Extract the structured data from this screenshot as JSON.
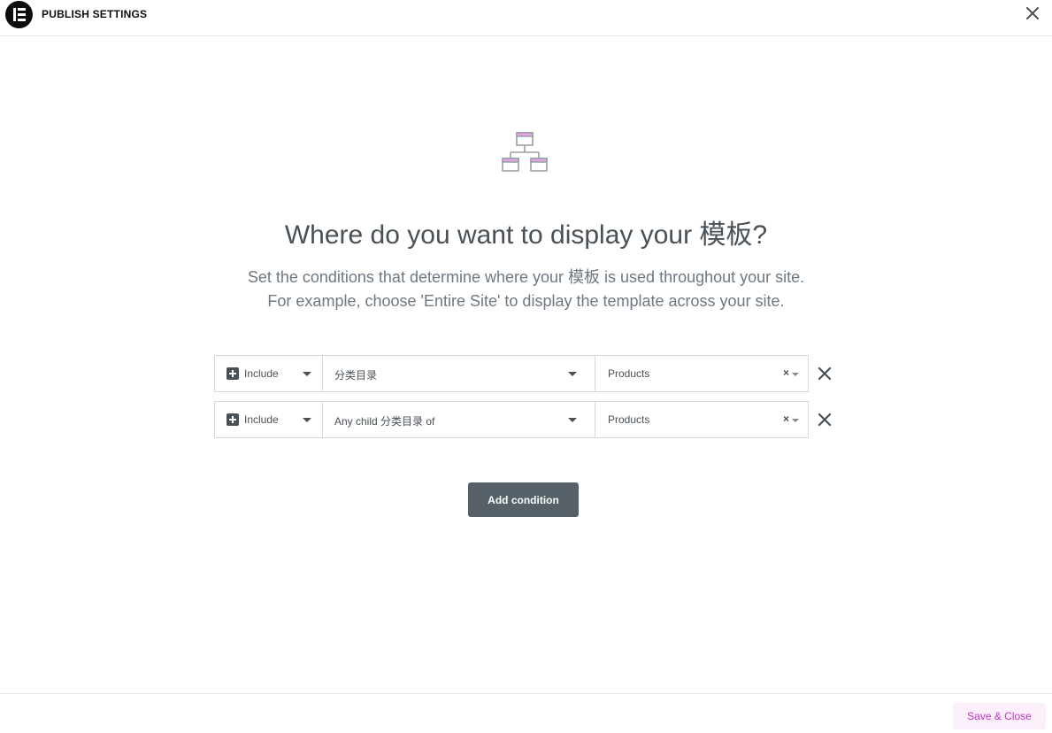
{
  "header": {
    "title": "PUBLISH SETTINGS",
    "logo_icon": "elementor-logo-icon",
    "close_icon": "close-icon"
  },
  "main": {
    "icon": "sitemap-icon",
    "title": "Where do you want to display your 模板?",
    "description_line1": "Set the conditions that determine where your 模板 is used throughout your site.",
    "description_line2": "For example, choose 'Entire Site' to display the template across your site."
  },
  "conditions": [
    {
      "type": "Include",
      "name": "分类目录",
      "sub": "Products",
      "clear": "×"
    },
    {
      "type": "Include",
      "name": "Any child 分类目录 of",
      "sub": "Products",
      "clear": "×"
    }
  ],
  "actions": {
    "add_condition_label": "Add condition",
    "save_close_label": "Save & Close"
  },
  "colors": {
    "accent_pink": "#c036c0",
    "button_dark": "#556068",
    "text": "#495157"
  }
}
